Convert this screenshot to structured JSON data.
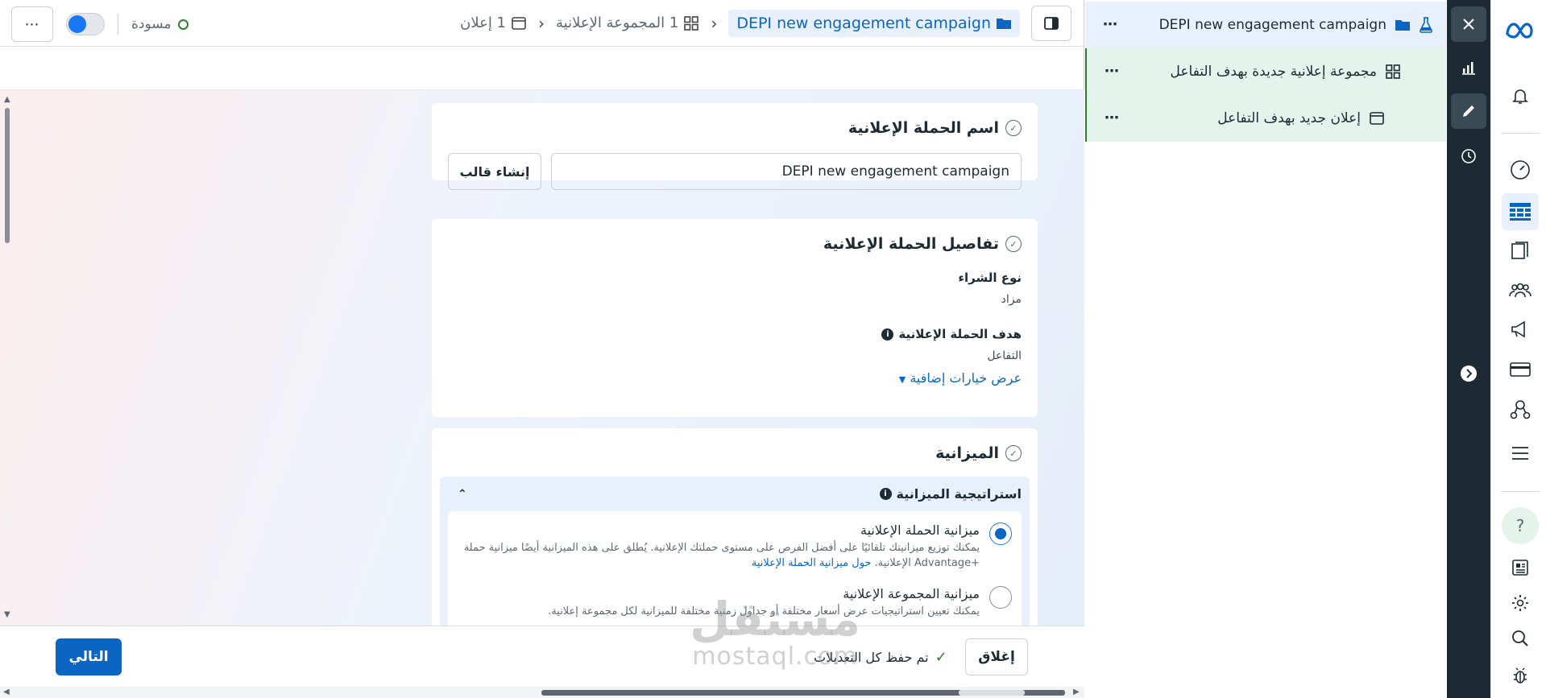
{
  "topbar": {
    "campaign_crumb": "DEPI new engagement campaign",
    "adset_crumb": "1 المجموعة الإعلانية",
    "ad_crumb": "1 إعلان",
    "status_label": "مسودة",
    "more_label": "⋯"
  },
  "campaign_name_card": {
    "title": "اسم الحملة الإعلانية",
    "name_value": "DEPI new engagement campaign",
    "create_template_label": "إنشاء قالب"
  },
  "campaign_details_card": {
    "title": "تفاصيل الحملة الإعلانية",
    "buying_type_label": "نوع الشراء",
    "buying_type_value": "مزاد",
    "objective_label": "هدف الحملة الإعلانية",
    "objective_value": "التفاعل",
    "more_options_link": "عرض خيارات إضافية"
  },
  "budget_card": {
    "title": "الميزانية",
    "strategy_label": "استراتيجية الميزانية",
    "options": [
      {
        "title": "ميزانية الحملة الإعلانية",
        "desc": "يمكنك توزيع ميزانيتك تلقائيًا على أفضل الفرص على مستوى حملتك الإعلانية. يُطلق على هذه الميزانية أيضًا ميزانية حملة +Advantage الإعلانية.",
        "link": "حول ميزانية الحملة الإعلانية",
        "selected": true
      },
      {
        "title": "ميزانية المجموعة الإعلانية",
        "desc": "يمكنك تعيين استراتيجيات عرض أسعار مختلفة أو جداول زمنية مختلفة للميزانية لكل مجموعة إعلانية.",
        "link": "",
        "selected": false
      }
    ]
  },
  "bottombar": {
    "next_label": "التالي",
    "close_label": "إغلاق",
    "saved_label": "تم حفظ كل التعديلات"
  },
  "watermark": {
    "line1": "مستقل",
    "line2": "mostaql.com"
  },
  "tree": {
    "items": [
      {
        "label": "DEPI new engagement campaign",
        "icon": "folder-icon"
      },
      {
        "label": "مجموعة إعلانية جديدة بهدف التفاعل",
        "icon": "grid-icon"
      },
      {
        "label": "إعلان جديد بهدف التفاعل",
        "icon": "ad-icon"
      }
    ],
    "more_label": "⋯"
  },
  "nav": {
    "help_label": "?"
  },
  "colors": {
    "accent": "#0a66c2",
    "rail": "#1c2b33",
    "tree_campaign_bg": "#e7f0fb",
    "tree_child_bg": "#e4f3ec",
    "success": "#2e7d32"
  }
}
